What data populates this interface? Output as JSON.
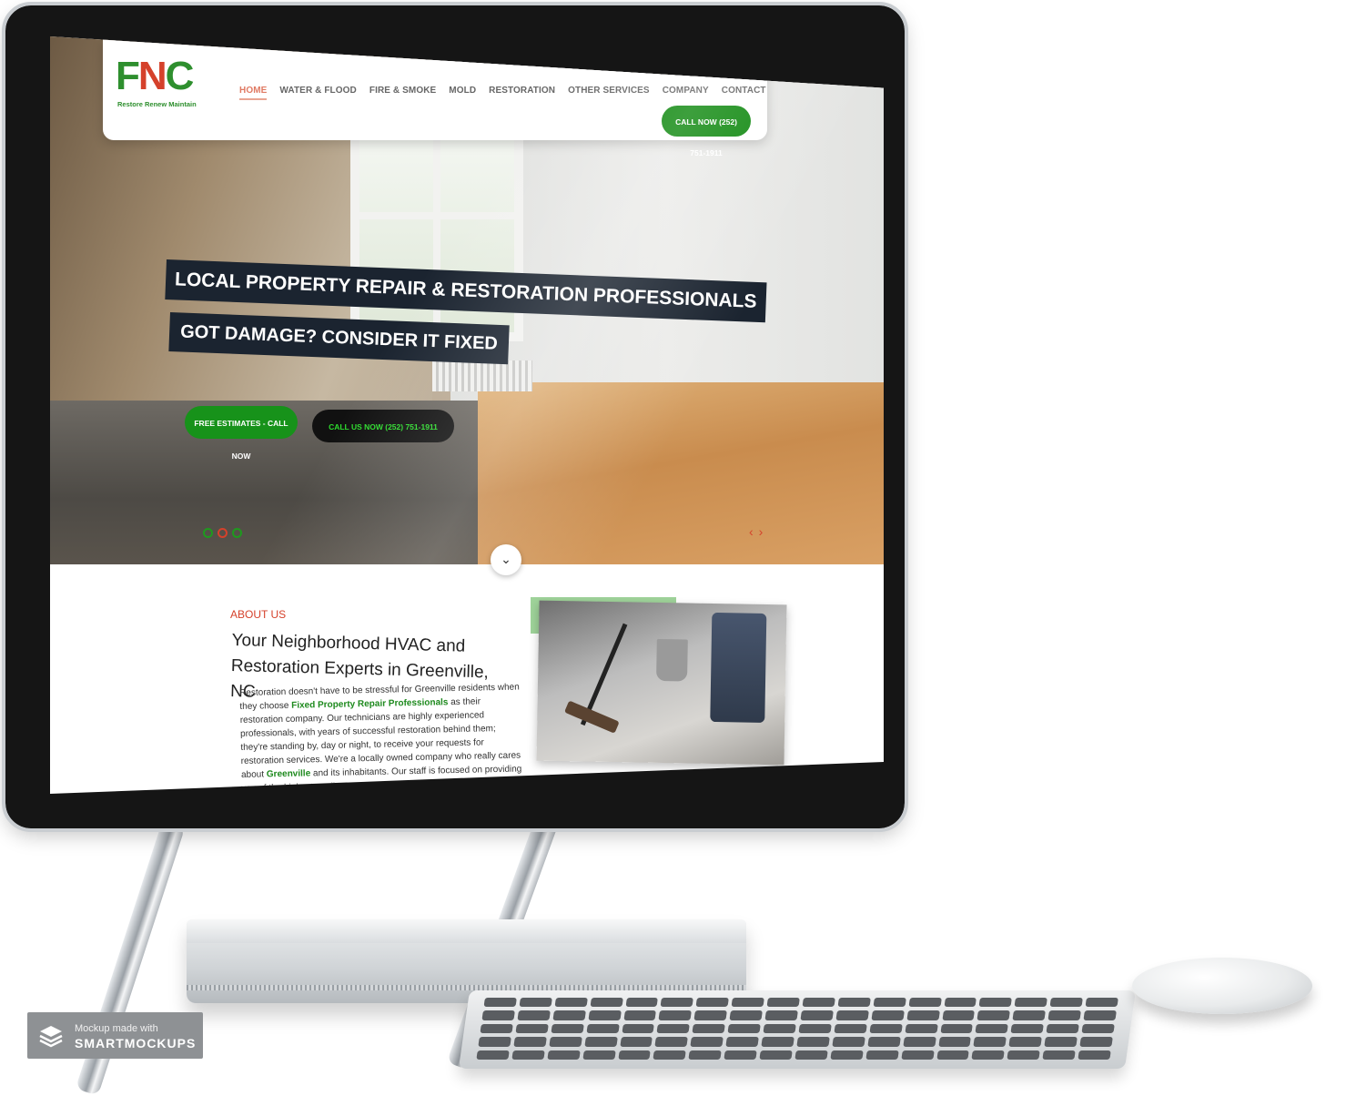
{
  "site": {
    "logo": {
      "letters_left": "F",
      "letters_mid": "N",
      "letters_right": "C",
      "tagline": "Restore Renew Maintain"
    },
    "nav": {
      "items": [
        "HOME",
        "WATER & FLOOD",
        "FIRE & SMOKE",
        "MOLD",
        "RESTORATION",
        "OTHER SERVICES",
        "COMPANY",
        "CONTACT"
      ],
      "active": "HOME",
      "call_button": "CALL NOW (252) 751-1911"
    },
    "hero": {
      "headline": "LOCAL PROPERTY REPAIR & RESTORATION PROFESSIONALS",
      "subheadline": "GOT DAMAGE? CONSIDER IT FIXED",
      "btn_estimates": "FREE ESTIMATES - CALL NOW",
      "btn_call": "CALL US NOW (252) 751-1911",
      "arrows": {
        "prev": "‹",
        "next": "›"
      },
      "scroll_icon": "⌄"
    },
    "about": {
      "label": "ABOUT US",
      "title": "Your Neighborhood HVAC and Restoration Experts in Greenville, NC",
      "body_1": "Restoration doesn't have to be stressful for Greenville residents when they choose ",
      "link_1": "Fixed Property Repair Professionals",
      "body_2": " as their restoration company. Our technicians are highly experienced professionals, with years of successful restoration behind them; they're standing by, day or night, to receive your requests for restoration services. We're a locally owned company who really cares about ",
      "link_2": "Greenville",
      "body_3": " and its inhabitants. Our staff is focused on providing you of the highest quality customer service in the"
    }
  },
  "watermark": {
    "line1": "Mockup made with",
    "line2": "SMARTMOCKUPS"
  },
  "colors": {
    "brand_green": "#128a12",
    "accent_red": "#d5412b",
    "banner_dark": "#1b2430"
  }
}
